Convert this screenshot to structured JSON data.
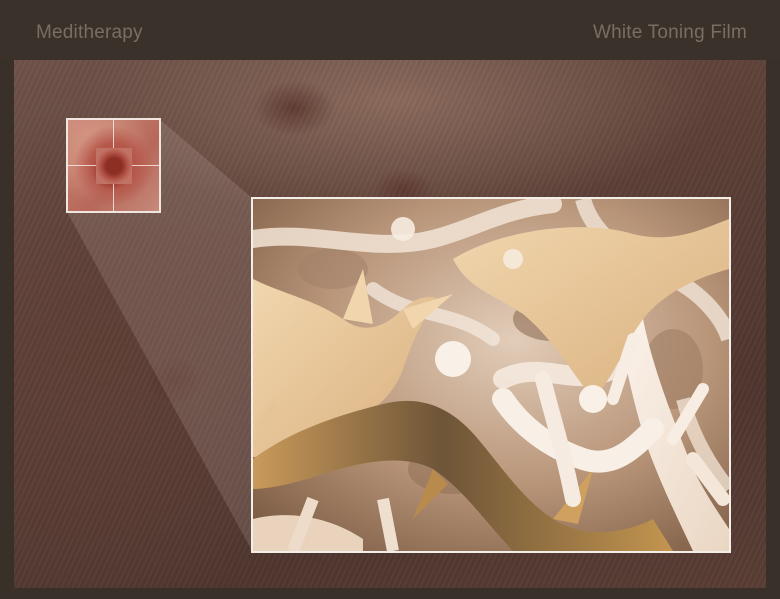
{
  "header": {
    "brand": "Meditherapy",
    "product": "White Toning Film"
  },
  "colors": {
    "header_bg": "#3b312b",
    "header_text": "#7a6d63",
    "frame_border": "#f4eee9",
    "skin_tone": "#6f534a",
    "structure_tone": "#f3e3d3"
  },
  "media": {
    "background": "skin-closeup-photo",
    "inset": "pore-closeup-thumbnail",
    "magnified": "microscopic-fiber-structure"
  }
}
